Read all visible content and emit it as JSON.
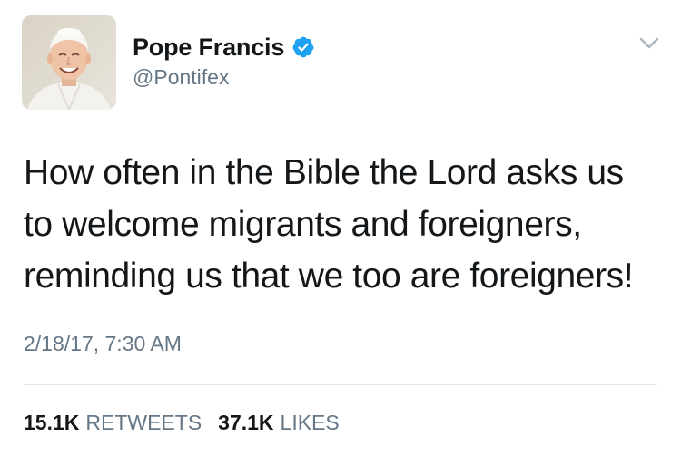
{
  "tweet": {
    "author": {
      "display_name": "Pope Francis",
      "handle": "@Pontifex",
      "verified": true,
      "avatar_icon": "profile-photo"
    },
    "text": "How often in the Bible the Lord asks us\nto welcome migrants and foreigners,\nreminding us that we too are foreigners!",
    "timestamp": "2/18/17, 7:30 AM",
    "stats": {
      "retweets_count": "15.1K",
      "retweets_label": "RETWEETS",
      "likes_count": "37.1K",
      "likes_label": "LIKES"
    }
  },
  "colors": {
    "primary_text": "#14171a",
    "secondary_text": "#657786",
    "verified_blue": "#1da1f2",
    "divider": "#e1e8ed"
  },
  "icons": {
    "verified": "verified-badge-icon",
    "menu": "chevron-down-icon"
  }
}
